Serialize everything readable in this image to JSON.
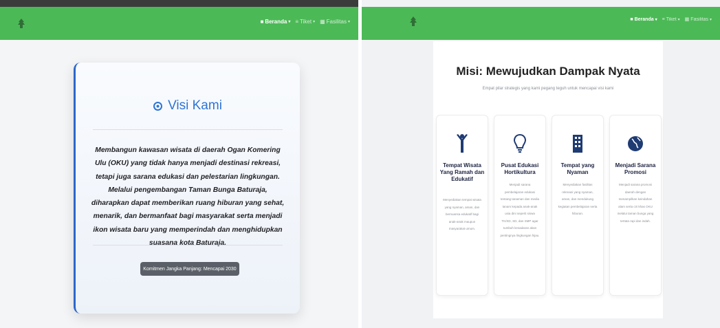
{
  "navbar": {
    "items": [
      {
        "label": "Beranda",
        "active": true
      },
      {
        "label": "Tiket",
        "active": false
      },
      {
        "label": "Fasilitas",
        "active": false
      }
    ],
    "caret": "▾",
    "bg_color": "#4cb957"
  },
  "visi": {
    "title": "Visi Kami",
    "text": "Membangun kawasan wisata di daerah Ogan Komering Ulu (OKU) yang tidak hanya menjadi destinasi rekreasi, tetapi juga sarana edukasi dan pelestarian lingkungan. Melalui pengembangan Taman Bunga Baturaja, diharapkan dapat memberikan ruang hiburan yang sehat, menarik, dan bermanfaat bagi masyarakat serta menjadi ikon wisata baru yang memperindah dan menghidupkan suasana kota Baturaja.",
    "badge": "Komitmen Jangka Panjang: Mencapai 2030",
    "accent_color": "#2e74d6"
  },
  "misi": {
    "title": "Misi: Mewujudkan Dampak Nyata",
    "subtitle": "Empat pilar strategis yang kami pegang teguh untuk mencapai visi kami",
    "cards": [
      {
        "title": "Tempat Wisata Yang Ramah dan Edukatif",
        "desc": "Menyediakan tempat wisata yang nyaman, aman, dan bernuansa edukatif bagi anak-anak maupun masyarakat umum.",
        "icon": "person-icon"
      },
      {
        "title": "Pusat Edukasi Hortikultura",
        "desc": "Menjadi sarana pembelajaran edukasi tentang tanaman dan media tanam kepada anak-anak usia dini seperti siswa TK/SD, SD, dan SMP agar tumbuh kesadaran akan pentingnya lingkungan hijau.",
        "icon": "lightbulb-icon"
      },
      {
        "title": "Tempat yang Nyaman",
        "desc": "Menyediakan fasilitas rekreasi yang nyaman, aman, dan mendukung kegiatan pembelajaran serta hiburan.",
        "icon": "building-icon"
      },
      {
        "title": "Menjadi Sarana Promosi",
        "desc": "Menjadi sarana promosi daerah dengan menampilkan keindahan alam serta ciri khas OKU melalui taman bunga yang tertata rapi dan indah.",
        "icon": "globe-icon"
      }
    ]
  }
}
